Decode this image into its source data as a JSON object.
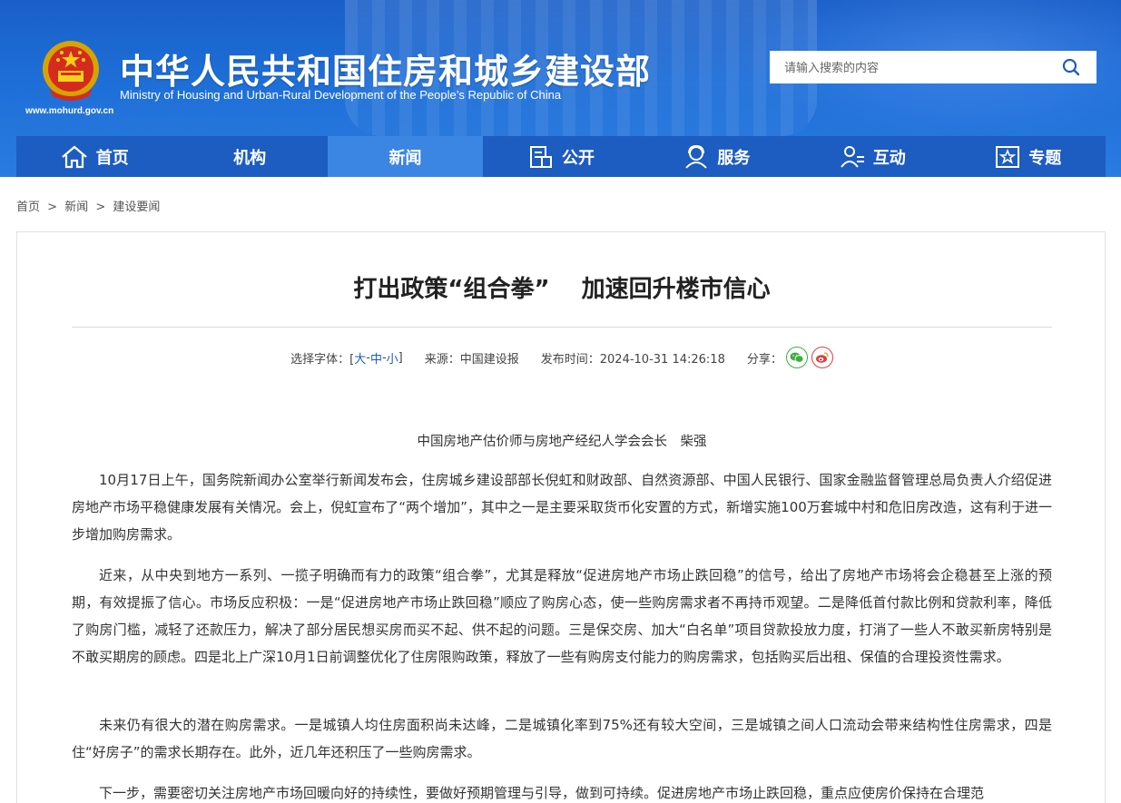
{
  "header": {
    "site_title": "中华人民共和国住房和城乡建设部",
    "site_subtitle": "Ministry of Housing and Urban-Rural Development of the People’s Republic of China",
    "site_url": "www.mohurd.gov.cn",
    "search_placeholder": "请输入搜索的内容"
  },
  "nav": [
    {
      "label": "首页",
      "icon": "home-icon"
    },
    {
      "label": "机构",
      "icon": ""
    },
    {
      "label": "新闻",
      "icon": "",
      "active": true
    },
    {
      "label": "公开",
      "icon": "document-icon"
    },
    {
      "label": "服务",
      "icon": "service-icon"
    },
    {
      "label": "互动",
      "icon": "interaction-icon"
    },
    {
      "label": "专题",
      "icon": "topic-star-icon"
    }
  ],
  "breadcrumb": [
    "首页",
    "新闻",
    "建设要闻"
  ],
  "article": {
    "title": "打出政策“组合拳”　 加速回升楼市信心",
    "meta": {
      "font_label": "选择字体：[",
      "font_large": "大",
      "font_medium": "中",
      "font_small": "小",
      "font_dash": "-",
      "font_close": "]",
      "source": "来源：中国建设报",
      "publish_time": "发布时间：2024-10-31 14:26:18",
      "share_label": "分享："
    },
    "author": "中国房地产估价师与房地产经纪人学会会长　柴强",
    "paragraphs": [
      "10月17日上午，国务院新闻办公室举行新闻发布会，住房城乡建设部部长倪虹和财政部、自然资源部、中国人民银行、国家金融监督管理总局负责人介绍促进房地产市场平稳健康发展有关情况。会上，倪虹宣布了“两个增加”，其中之一是主要采取货币化安置的方式，新增实施100万套城中村和危旧房改造，这有利于进一步增加购房需求。",
      "近来，从中央到地方一系列、一揽子明确而有力的政策“组合拳”，尤其是释放“促进房地产市场止跌回稳”的信号，给出了房地产市场将会企稳甚至上涨的预期，有效提振了信心。市场反应积极：一是“促进房地产市场止跌回稳”顺应了购房心态，使一些购房需求者不再持币观望。二是降低首付款比例和贷款利率，降低了购房门槛，减轻了还款压力，解决了部分居民想买房而买不起、供不起的问题。三是保交房、加大“白名单”项目贷款投放力度，打消了一些人不敢买新房特别是不敢买期房的顾虑。四是北上广深10月1日前调整优化了住房限购政策，释放了一些有购房支付能力的购房需求，包括购买后出租、保值的合理投资性需求。",
      "未来仍有很大的潜在购房需求。一是城镇人均住房面积尚未达峰，二是城镇化率到75%还有较大空间，三是城镇之间人口流动会带来结构性住房需求，四是住“好房子”的需求长期存在。此外，近几年还积压了一些购房需求。",
      "下一步，需要密切关注房地产市场回暖向好的持续性，要做好预期管理与引导，做到可持续。促进房地产市场止跌回稳，重点应使房价保持在合理范"
    ]
  },
  "colors": {
    "header_blue": "#1e6ed8",
    "nav_blue": "#1d5cc0",
    "nav_active": "#3b86e3"
  }
}
